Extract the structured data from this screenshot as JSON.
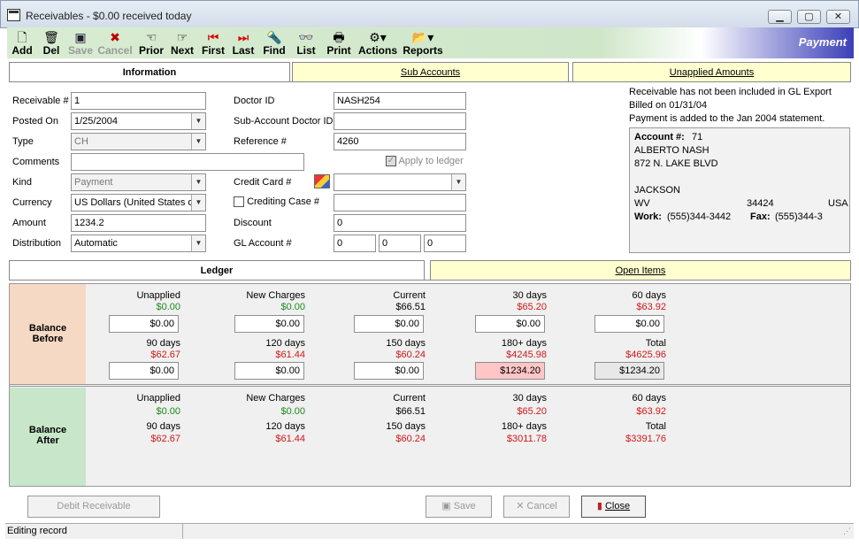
{
  "window": {
    "title": "Receivables  - $0.00 received today",
    "min": "▁",
    "max": "▢",
    "close": "✕"
  },
  "toolbar": {
    "mode": "Payment",
    "buttons": [
      {
        "label": "Add",
        "icon": "new-doc-icon"
      },
      {
        "label": "Del",
        "icon": "trash-icon"
      },
      {
        "label": "Save",
        "icon": "floppy-icon"
      },
      {
        "label": "Cancel",
        "icon": "x-icon"
      },
      {
        "label": "Prior",
        "icon": "hand-left-icon"
      },
      {
        "label": "Next",
        "icon": "hand-right-icon"
      },
      {
        "label": "First",
        "icon": "first-icon"
      },
      {
        "label": "Last",
        "icon": "last-icon"
      },
      {
        "label": "Find",
        "icon": "flashlight-icon"
      },
      {
        "label": "List",
        "icon": "glasses-icon"
      },
      {
        "label": "Print",
        "icon": "printer-icon"
      },
      {
        "label": "Actions",
        "icon": "actions-icon"
      },
      {
        "label": "Reports",
        "icon": "reports-icon"
      }
    ]
  },
  "tabs": {
    "information": "Information",
    "sub_accounts": "Sub Accounts",
    "unapplied": "Unapplied Amounts",
    "ledger": "Ledger",
    "open_items": "Open Items"
  },
  "form": {
    "receivable_label": "Receivable #",
    "receivable_value": "1",
    "posted_label": "Posted On",
    "posted_value": "1/25/2004",
    "type_label": "Type",
    "type_value": "CH",
    "comments_label": "Comments",
    "comments_value": "",
    "kind_label": "Kind",
    "kind_value": "Payment",
    "currency_label": "Currency",
    "currency_value": "US Dollars  (United States o",
    "amount_label": "Amount",
    "amount_value": "1234.2",
    "distribution_label": "Distribution",
    "distribution_value": "Automatic",
    "doctor_label": "Doctor ID",
    "doctor_value": "NASH254",
    "subacct_label": "Sub-Account Doctor ID",
    "subacct_value": "",
    "reference_label": "Reference #",
    "reference_value": "4260",
    "apply_label": "Apply to ledger",
    "credit_label": "Credit Card #",
    "credit_value": "",
    "crediting_label": "Crediting Case #",
    "crediting_value": "",
    "discount_label": "Discount",
    "discount_value": "0",
    "gl_label": "GL Account #",
    "gl_values": [
      "0",
      "0",
      "0"
    ]
  },
  "account_info": {
    "msg1": "Receivable has not been included in GL Export",
    "msg2": "Billed on 01/31/04",
    "msg3": "Payment is added to the Jan 2004 statement.",
    "account_label": "Account #:",
    "account_no": "71",
    "name": "ALBERTO  NASH",
    "address": "872 N. LAKE BLVD",
    "city": "JACKSON",
    "state": "WV",
    "zip": "34424",
    "country": "USA",
    "work_label": "Work:",
    "work": "(555)344-3442",
    "fax_label": "Fax:",
    "fax": "(555)344-3"
  },
  "ledger": {
    "before_label": "Balance Before",
    "after_label": "Balance After",
    "before_row1": [
      {
        "head": "Unapplied",
        "val": "$0.00",
        "color": "green",
        "input": "$0.00"
      },
      {
        "head": "New Charges",
        "val": "$0.00",
        "color": "green",
        "input": "$0.00"
      },
      {
        "head": "Current",
        "val": "$66.51",
        "color": "black",
        "input": "$0.00"
      },
      {
        "head": "30 days",
        "val": "$65.20",
        "color": "red",
        "input": "$0.00"
      },
      {
        "head": "60 days",
        "val": "$63.92",
        "color": "red",
        "input": "$0.00"
      }
    ],
    "before_row2": [
      {
        "head": "90 days",
        "val": "$62.67",
        "color": "red",
        "input": "$0.00"
      },
      {
        "head": "120 days",
        "val": "$61.44",
        "color": "red",
        "input": "$0.00"
      },
      {
        "head": "150 days",
        "val": "$60.24",
        "color": "red",
        "input": "$0.00"
      },
      {
        "head": "180+ days",
        "val": "$4245.98",
        "color": "red",
        "input": "$1234.20"
      },
      {
        "head": "Total",
        "val": "$4625.96",
        "color": "red",
        "input": "$1234.20"
      }
    ],
    "after_row1": [
      {
        "head": "Unapplied",
        "val": "$0.00",
        "color": "green"
      },
      {
        "head": "New Charges",
        "val": "$0.00",
        "color": "green"
      },
      {
        "head": "Current",
        "val": "$66.51",
        "color": "black"
      },
      {
        "head": "30 days",
        "val": "$65.20",
        "color": "red"
      },
      {
        "head": "60 days",
        "val": "$63.92",
        "color": "red"
      }
    ],
    "after_row2": [
      {
        "head": "90 days",
        "val": "$62.67",
        "color": "red"
      },
      {
        "head": "120 days",
        "val": "$61.44",
        "color": "red"
      },
      {
        "head": "150 days",
        "val": "$60.24",
        "color": "red"
      },
      {
        "head": "180+ days",
        "val": "$3011.78",
        "color": "red"
      },
      {
        "head": "Total",
        "val": "$3391.76",
        "color": "red"
      }
    ]
  },
  "buttons": {
    "debit": "Debit Receivable",
    "save": "Save",
    "cancel": "Cancel",
    "close": "Close"
  },
  "status": "Editing record"
}
